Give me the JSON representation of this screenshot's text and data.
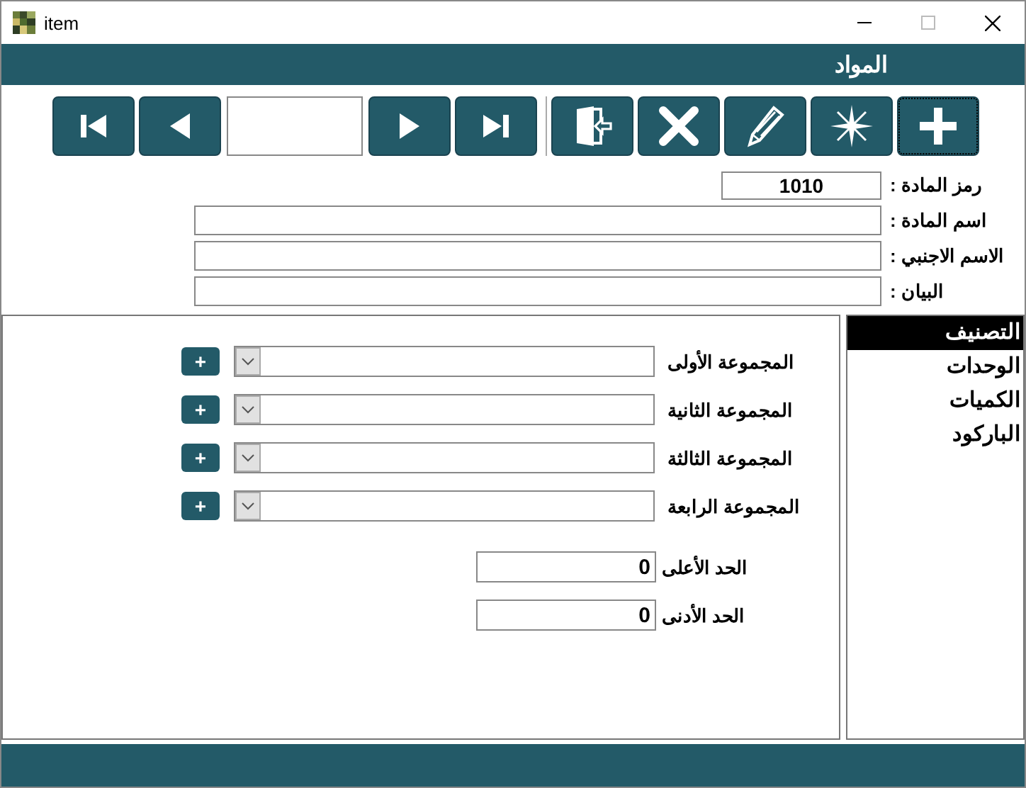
{
  "window": {
    "title": "item"
  },
  "header": {
    "title": "المواد"
  },
  "toolbar": {
    "buttons": [
      {
        "kind": "first",
        "focused": false
      },
      {
        "kind": "previous",
        "focused": false
      },
      {
        "kind": "record_field"
      },
      {
        "kind": "next",
        "focused": false
      },
      {
        "kind": "last",
        "focused": false
      },
      {
        "kind": "separator"
      },
      {
        "kind": "exit",
        "focused": false
      },
      {
        "kind": "delete",
        "focused": false
      },
      {
        "kind": "edit",
        "focused": false
      },
      {
        "kind": "new",
        "focused": false
      },
      {
        "kind": "add",
        "focused": true
      }
    ]
  },
  "fields": [
    {
      "label": "رمز المادة :",
      "value": "1010",
      "kind": "code"
    },
    {
      "label": "اسم المادة :",
      "kind": "wide"
    },
    {
      "label": "الاسم الاجنبي :",
      "kind": "wide"
    },
    {
      "label": "البيان :",
      "kind": "wide"
    }
  ],
  "groups": [
    {
      "label": "المجموعة الأولى",
      "add": "+"
    },
    {
      "label": "المجموعة الثانية",
      "add": "+"
    },
    {
      "label": "المجموعة الثالثة",
      "add": "+"
    },
    {
      "label": "المجموعة الرابعة",
      "add": "+"
    }
  ],
  "limits": [
    {
      "label": "الحد الأعلى",
      "value": "0"
    },
    {
      "label": "الحد الأدنى",
      "value": "0"
    }
  ],
  "sections": [
    {
      "label": "التصنيف",
      "selected": true
    },
    {
      "label": "الوحدات",
      "selected": false
    },
    {
      "label": "الكميات",
      "selected": false
    },
    {
      "label": "الباركود",
      "selected": false
    }
  ]
}
